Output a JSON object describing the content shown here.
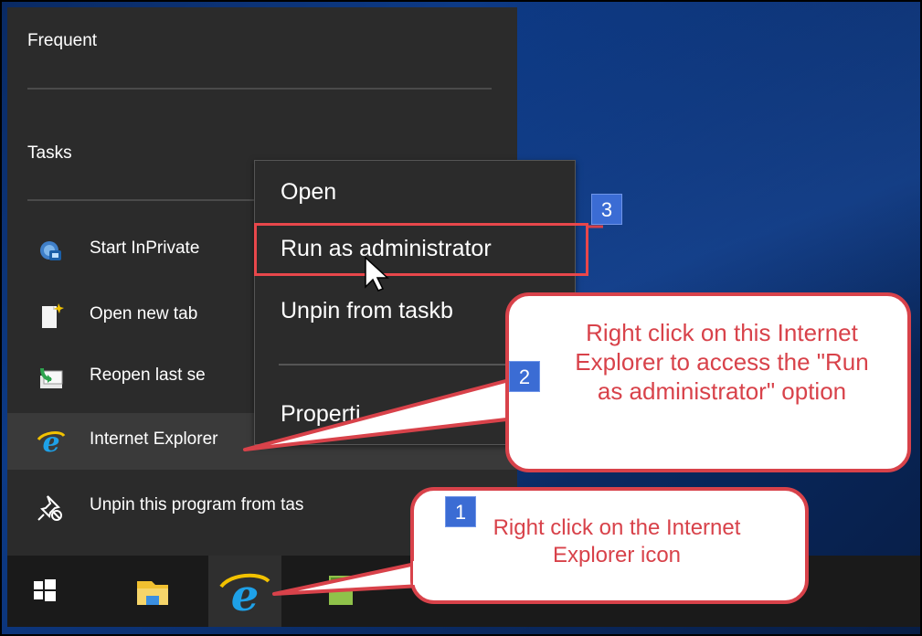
{
  "jumplist": {
    "frequent_label": "Frequent",
    "tasks_label": "Tasks",
    "tasks": [
      {
        "label": "Start InPrivate",
        "icon": "inprivate-icon"
      },
      {
        "label": "Open new tab",
        "icon": "new-tab-icon"
      },
      {
        "label": "Reopen last se",
        "icon": "reopen-session-icon"
      }
    ],
    "app_label": "Internet Explorer",
    "unpin_label": "Unpin this program from tas"
  },
  "context_menu": {
    "open": "Open",
    "run_as_admin": "Run as administrator",
    "unpin": "Unpin from taskb",
    "properties": "Properti"
  },
  "annotations": {
    "step1_number": "1",
    "step1_text": "Right click on the Internet Explorer icon",
    "step2_number": "2",
    "step2_text": "Right click on this Internet Explorer to access the \"Run as administrator\" option",
    "step3_number": "3"
  },
  "colors": {
    "annotation_red": "#d8424a",
    "badge_blue": "#3b6cd4",
    "menu_bg": "#2b2b2b",
    "ie_blue": "#1ea1e8"
  },
  "taskbar": {
    "buttons": [
      "windows-start-icon",
      "file-explorer-icon",
      "internet-explorer-icon",
      "notepad-icon"
    ]
  }
}
